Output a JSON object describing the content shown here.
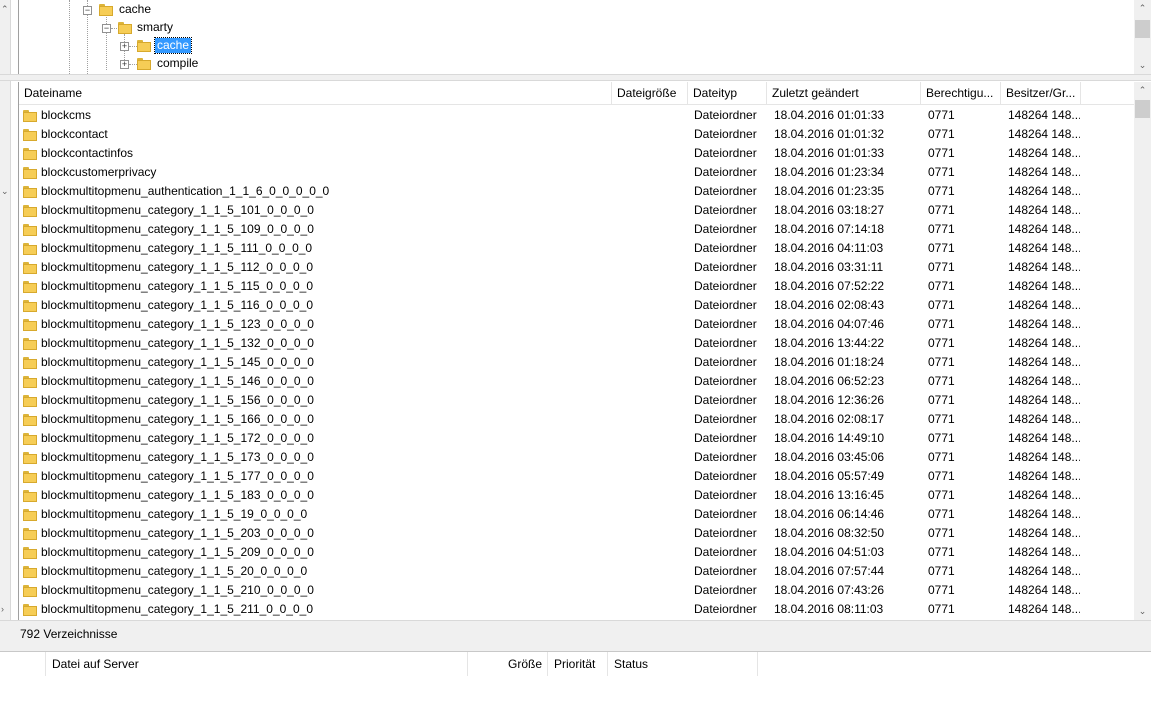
{
  "tree": {
    "nodes": [
      {
        "label": "cache",
        "expanded": true,
        "selected": false
      },
      {
        "label": "smarty",
        "expanded": true,
        "selected": false
      },
      {
        "label": "cache",
        "expanded": false,
        "selected": true
      },
      {
        "label": "compile",
        "expanded": false,
        "selected": false
      }
    ]
  },
  "file_list": {
    "columns": {
      "name": "Dateiname",
      "size": "Dateigröße",
      "type": "Dateityp",
      "modified": "Zuletzt geändert",
      "perms": "Berechtigu...",
      "owner": "Besitzer/Gr..."
    },
    "rows": [
      {
        "name": "blockcms",
        "size": "",
        "type": "Dateiordner",
        "modified": "18.04.2016 01:01:33",
        "perms": "0771",
        "owner": "148264 148..."
      },
      {
        "name": "blockcontact",
        "size": "",
        "type": "Dateiordner",
        "modified": "18.04.2016 01:01:32",
        "perms": "0771",
        "owner": "148264 148..."
      },
      {
        "name": "blockcontactinfos",
        "size": "",
        "type": "Dateiordner",
        "modified": "18.04.2016 01:01:33",
        "perms": "0771",
        "owner": "148264 148..."
      },
      {
        "name": "blockcustomerprivacy",
        "size": "",
        "type": "Dateiordner",
        "modified": "18.04.2016 01:23:34",
        "perms": "0771",
        "owner": "148264 148..."
      },
      {
        "name": "blockmultitopmenu_authentication_1_1_6_0_0_0_0_0",
        "size": "",
        "type": "Dateiordner",
        "modified": "18.04.2016 01:23:35",
        "perms": "0771",
        "owner": "148264 148..."
      },
      {
        "name": "blockmultitopmenu_category_1_1_5_101_0_0_0_0",
        "size": "",
        "type": "Dateiordner",
        "modified": "18.04.2016 03:18:27",
        "perms": "0771",
        "owner": "148264 148..."
      },
      {
        "name": "blockmultitopmenu_category_1_1_5_109_0_0_0_0",
        "size": "",
        "type": "Dateiordner",
        "modified": "18.04.2016 07:14:18",
        "perms": "0771",
        "owner": "148264 148..."
      },
      {
        "name": "blockmultitopmenu_category_1_1_5_111_0_0_0_0",
        "size": "",
        "type": "Dateiordner",
        "modified": "18.04.2016 04:11:03",
        "perms": "0771",
        "owner": "148264 148..."
      },
      {
        "name": "blockmultitopmenu_category_1_1_5_112_0_0_0_0",
        "size": "",
        "type": "Dateiordner",
        "modified": "18.04.2016 03:31:11",
        "perms": "0771",
        "owner": "148264 148..."
      },
      {
        "name": "blockmultitopmenu_category_1_1_5_115_0_0_0_0",
        "size": "",
        "type": "Dateiordner",
        "modified": "18.04.2016 07:52:22",
        "perms": "0771",
        "owner": "148264 148..."
      },
      {
        "name": "blockmultitopmenu_category_1_1_5_116_0_0_0_0",
        "size": "",
        "type": "Dateiordner",
        "modified": "18.04.2016 02:08:43",
        "perms": "0771",
        "owner": "148264 148..."
      },
      {
        "name": "blockmultitopmenu_category_1_1_5_123_0_0_0_0",
        "size": "",
        "type": "Dateiordner",
        "modified": "18.04.2016 04:07:46",
        "perms": "0771",
        "owner": "148264 148..."
      },
      {
        "name": "blockmultitopmenu_category_1_1_5_132_0_0_0_0",
        "size": "",
        "type": "Dateiordner",
        "modified": "18.04.2016 13:44:22",
        "perms": "0771",
        "owner": "148264 148..."
      },
      {
        "name": "blockmultitopmenu_category_1_1_5_145_0_0_0_0",
        "size": "",
        "type": "Dateiordner",
        "modified": "18.04.2016 01:18:24",
        "perms": "0771",
        "owner": "148264 148..."
      },
      {
        "name": "blockmultitopmenu_category_1_1_5_146_0_0_0_0",
        "size": "",
        "type": "Dateiordner",
        "modified": "18.04.2016 06:52:23",
        "perms": "0771",
        "owner": "148264 148..."
      },
      {
        "name": "blockmultitopmenu_category_1_1_5_156_0_0_0_0",
        "size": "",
        "type": "Dateiordner",
        "modified": "18.04.2016 12:36:26",
        "perms": "0771",
        "owner": "148264 148..."
      },
      {
        "name": "blockmultitopmenu_category_1_1_5_166_0_0_0_0",
        "size": "",
        "type": "Dateiordner",
        "modified": "18.04.2016 02:08:17",
        "perms": "0771",
        "owner": "148264 148..."
      },
      {
        "name": "blockmultitopmenu_category_1_1_5_172_0_0_0_0",
        "size": "",
        "type": "Dateiordner",
        "modified": "18.04.2016 14:49:10",
        "perms": "0771",
        "owner": "148264 148..."
      },
      {
        "name": "blockmultitopmenu_category_1_1_5_173_0_0_0_0",
        "size": "",
        "type": "Dateiordner",
        "modified": "18.04.2016 03:45:06",
        "perms": "0771",
        "owner": "148264 148..."
      },
      {
        "name": "blockmultitopmenu_category_1_1_5_177_0_0_0_0",
        "size": "",
        "type": "Dateiordner",
        "modified": "18.04.2016 05:57:49",
        "perms": "0771",
        "owner": "148264 148..."
      },
      {
        "name": "blockmultitopmenu_category_1_1_5_183_0_0_0_0",
        "size": "",
        "type": "Dateiordner",
        "modified": "18.04.2016 13:16:45",
        "perms": "0771",
        "owner": "148264 148..."
      },
      {
        "name": "blockmultitopmenu_category_1_1_5_19_0_0_0_0",
        "size": "",
        "type": "Dateiordner",
        "modified": "18.04.2016 06:14:46",
        "perms": "0771",
        "owner": "148264 148..."
      },
      {
        "name": "blockmultitopmenu_category_1_1_5_203_0_0_0_0",
        "size": "",
        "type": "Dateiordner",
        "modified": "18.04.2016 08:32:50",
        "perms": "0771",
        "owner": "148264 148..."
      },
      {
        "name": "blockmultitopmenu_category_1_1_5_209_0_0_0_0",
        "size": "",
        "type": "Dateiordner",
        "modified": "18.04.2016 04:51:03",
        "perms": "0771",
        "owner": "148264 148..."
      },
      {
        "name": "blockmultitopmenu_category_1_1_5_20_0_0_0_0",
        "size": "",
        "type": "Dateiordner",
        "modified": "18.04.2016 07:57:44",
        "perms": "0771",
        "owner": "148264 148..."
      },
      {
        "name": "blockmultitopmenu_category_1_1_5_210_0_0_0_0",
        "size": "",
        "type": "Dateiordner",
        "modified": "18.04.2016 07:43:26",
        "perms": "0771",
        "owner": "148264 148..."
      },
      {
        "name": "blockmultitopmenu_category_1_1_5_211_0_0_0_0",
        "size": "",
        "type": "Dateiordner",
        "modified": "18.04.2016 08:11:03",
        "perms": "0771",
        "owner": "148264 148..."
      }
    ]
  },
  "status": {
    "text": "792 Verzeichnisse"
  },
  "queue": {
    "columns": {
      "file": "Datei auf Server",
      "size": "Größe",
      "priority": "Priorität",
      "status": "Status"
    }
  },
  "colors": {
    "selection": "#3399ff",
    "folder": "#f6cd56"
  }
}
